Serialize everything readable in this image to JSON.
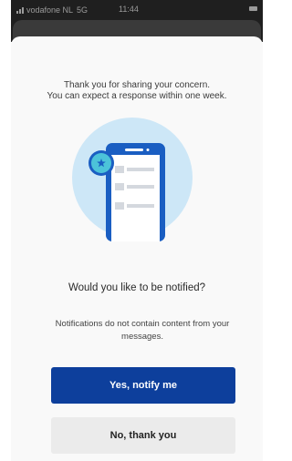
{
  "status_bar": {
    "carrier": "vodafone NL",
    "network": "5G",
    "time": "11:44",
    "signal_icon": "signal-bars-icon",
    "battery_icon": "battery-icon"
  },
  "dialog": {
    "thanks_line1": "Thank you for sharing your concern.",
    "thanks_line2": "You can expect a response within one week.",
    "illustration_icon": "phone-chat-illustration-icon",
    "question": "Would you like to be notified?",
    "info": "Notifications do not contain content from your messages.",
    "primary_button": "Yes, notify me",
    "secondary_button": "No, thank you"
  },
  "colors": {
    "accent": "#0d3f9c",
    "phone_blue": "#1a5ec2",
    "illustration_bg": "#cde7f7",
    "bubble": "#4cc3d9",
    "secondary_button_bg": "#ebebeb"
  }
}
